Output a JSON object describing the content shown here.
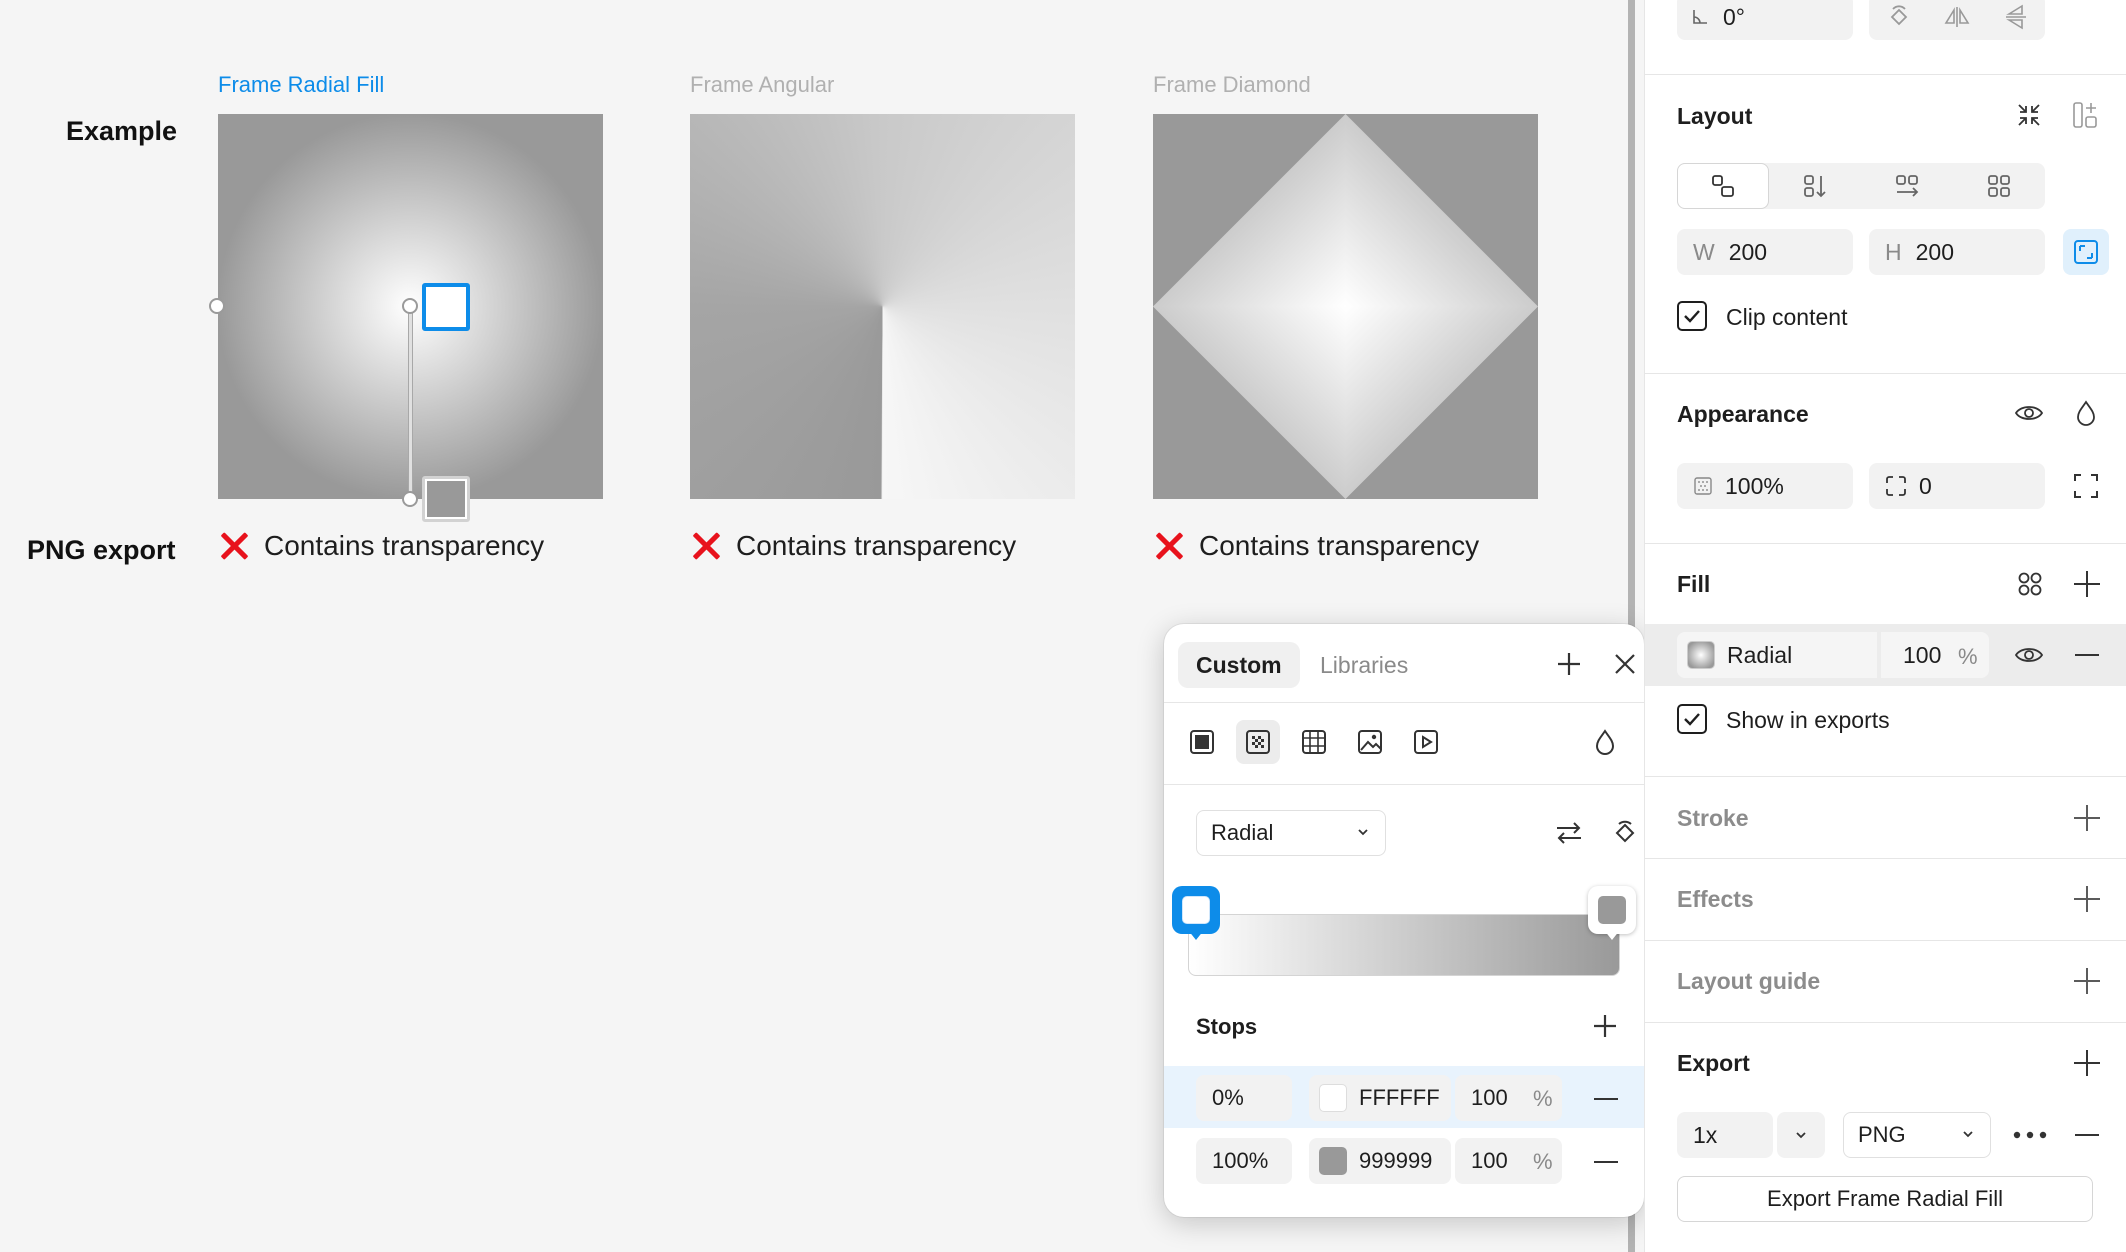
{
  "canvas": {
    "row_labels": {
      "example": "Example",
      "png_export": "PNG export"
    },
    "frames": [
      {
        "title": "Frame Radial Fill",
        "selected": true,
        "export_status": "Contains transparency"
      },
      {
        "title": "Frame Angular",
        "selected": false,
        "export_status": "Contains transparency"
      },
      {
        "title": "Frame Diamond",
        "selected": false,
        "export_status": "Contains transparency"
      }
    ]
  },
  "popover": {
    "tabs": {
      "custom": "Custom",
      "libraries": "Libraries"
    },
    "fill_type_icons": [
      "solid-fill-icon",
      "gradient-fill-icon",
      "pattern-fill-icon",
      "image-fill-icon",
      "video-fill-icon"
    ],
    "gradient_type": "Radial",
    "stops_label": "Stops",
    "stops": [
      {
        "position": "0%",
        "hex": "FFFFFF",
        "opacity": "100",
        "pct": "%",
        "color": "#FFFFFF"
      },
      {
        "position": "100%",
        "hex": "999999",
        "opacity": "100",
        "pct": "%",
        "color": "#999999"
      }
    ]
  },
  "panel": {
    "rotation": "0°",
    "layout": {
      "title": "Layout",
      "width_label": "W",
      "width": "200",
      "height_label": "H",
      "height": "200",
      "clip_content": "Clip content"
    },
    "appearance": {
      "title": "Appearance",
      "opacity": "100%",
      "corner_radius": "0"
    },
    "fill": {
      "title": "Fill",
      "type": "Radial",
      "opacity": "100",
      "pct": "%",
      "show_in_exports": "Show in exports"
    },
    "stroke": {
      "title": "Stroke"
    },
    "effects": {
      "title": "Effects"
    },
    "layout_guide": {
      "title": "Layout guide"
    },
    "export": {
      "title": "Export",
      "scale": "1x",
      "format": "PNG",
      "button": "Export Frame Radial Fill"
    }
  },
  "colors": {
    "accent": "#0D8CE9",
    "error": "#E8121C",
    "stop_start": "#FFFFFF",
    "stop_end": "#999999"
  }
}
